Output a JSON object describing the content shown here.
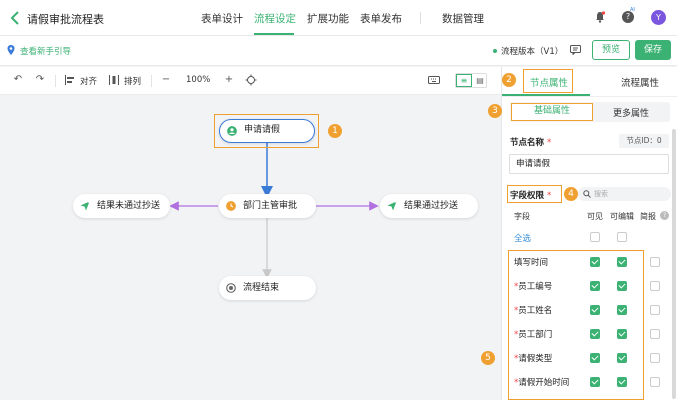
{
  "header": {
    "title": "请假审批流程表",
    "tabs": [
      {
        "label": "表单设计",
        "active": false
      },
      {
        "label": "流程设定",
        "active": true
      },
      {
        "label": "扩展功能",
        "active": false
      },
      {
        "label": "表单发布",
        "active": false
      },
      {
        "label": "数据管理",
        "active": false
      }
    ],
    "ai_badge": "AI",
    "help_glyph": "?",
    "avatar_letter": "Y"
  },
  "subbar": {
    "guide_link": "查看新手引导",
    "version": "流程版本（V1）",
    "preview": "预览",
    "save": "保存"
  },
  "toolbar": {
    "undo_glyph": "↶",
    "redo_glyph": "↷",
    "align": "对齐",
    "arrange": "排列",
    "zoom_out_glyph": "−",
    "zoom": "100%",
    "zoom_in_glyph": "+",
    "view_list_glyph": "≡",
    "view_grid_glyph": "▤"
  },
  "flow": {
    "start": "申请请假",
    "approval": "部门主管审批",
    "reject_cc": "结果未通过抄送",
    "pass_cc": "结果通过抄送",
    "end": "流程结束"
  },
  "badges": [
    "1",
    "2",
    "3",
    "4",
    "5"
  ],
  "panel": {
    "tabs": [
      "节点属性",
      "流程属性"
    ],
    "subtabs": [
      "基础属性",
      "更多属性"
    ],
    "node_name_label": "节点名称",
    "node_id": "节点ID：0",
    "node_name_value": "申请请假",
    "field_perm_label": "字段权限",
    "search_placeholder": "搜索",
    "required_mark": "*",
    "columns": [
      "字段",
      "可见",
      "可编辑",
      "简报"
    ],
    "help_glyph": "?",
    "select_all": "全选",
    "fields": [
      {
        "name": "填写时间",
        "required": false,
        "visible": true,
        "editable": true,
        "brief": false
      },
      {
        "name": "员工编号",
        "required": true,
        "visible": true,
        "editable": true,
        "brief": false
      },
      {
        "name": "员工姓名",
        "required": true,
        "visible": true,
        "editable": true,
        "brief": false
      },
      {
        "name": "员工部门",
        "required": true,
        "visible": true,
        "editable": true,
        "brief": false
      },
      {
        "name": "请假类型",
        "required": true,
        "visible": true,
        "editable": true,
        "brief": false
      },
      {
        "name": "请假开始时间",
        "required": true,
        "visible": true,
        "editable": true,
        "brief": false
      }
    ]
  },
  "colors": {
    "accent": "#3bb273",
    "highlight": "#f0a030",
    "edge_blue": "#3b7bd8",
    "edge_purple": "#b070e0",
    "edge_gray": "#c8c8c8"
  },
  "icons": [
    "back-icon",
    "bell-icon",
    "help-icon",
    "pin-icon",
    "comment-icon",
    "undo-icon",
    "redo-icon",
    "align-icon",
    "arrange-icon",
    "zoom-out-icon",
    "zoom-in-icon",
    "fit-icon",
    "keyboard-icon",
    "user-icon",
    "clock-icon",
    "send-icon",
    "end-icon",
    "search-icon"
  ]
}
